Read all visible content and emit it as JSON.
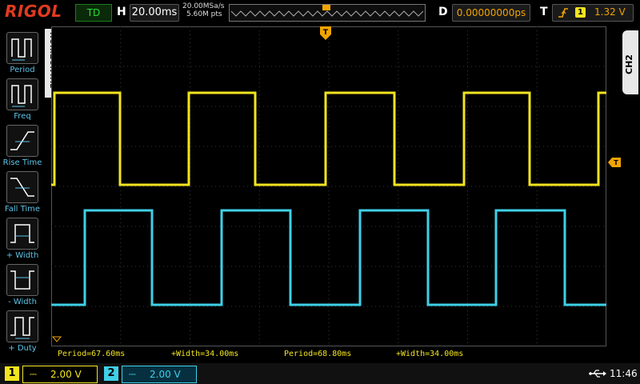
{
  "header": {
    "logo": "RIGOL",
    "run_status": "TD",
    "h_label": "H",
    "timebase": "20.00ms",
    "sample_rate": "20.00MSa/s",
    "memory_depth": "5.60M pts",
    "d_label": "D",
    "delay": "0.00000000ps",
    "t_label": "T",
    "trigger_source": "1",
    "trigger_level": "1.32 V"
  },
  "left_menu": {
    "tab_label": "HORIZONTAL",
    "items": [
      {
        "label": "Period"
      },
      {
        "label": "Freq"
      },
      {
        "label": "Rise Time"
      },
      {
        "label": "Fall Time"
      },
      {
        "label": "+ Width"
      },
      {
        "label": "- Width"
      },
      {
        "label": "+ Duty"
      }
    ]
  },
  "right_tab": {
    "label": "CH2"
  },
  "trigger_marker": "T",
  "measurements": [
    {
      "text": "Period=67.60ms"
    },
    {
      "text": "+Width=34.00ms"
    },
    {
      "text": "Period=68.80ms"
    },
    {
      "text": "+Width=34.00ms"
    }
  ],
  "channels": [
    {
      "num": "1",
      "scale": "2.00 V",
      "color": "#f2e41f"
    },
    {
      "num": "2",
      "scale": "2.00 V",
      "color": "#3fd0e8"
    }
  ],
  "clock": "11:46",
  "colors": {
    "ch1": "#f2e41f",
    "ch2": "#3fd0e8",
    "accent": "#f1a400"
  }
}
